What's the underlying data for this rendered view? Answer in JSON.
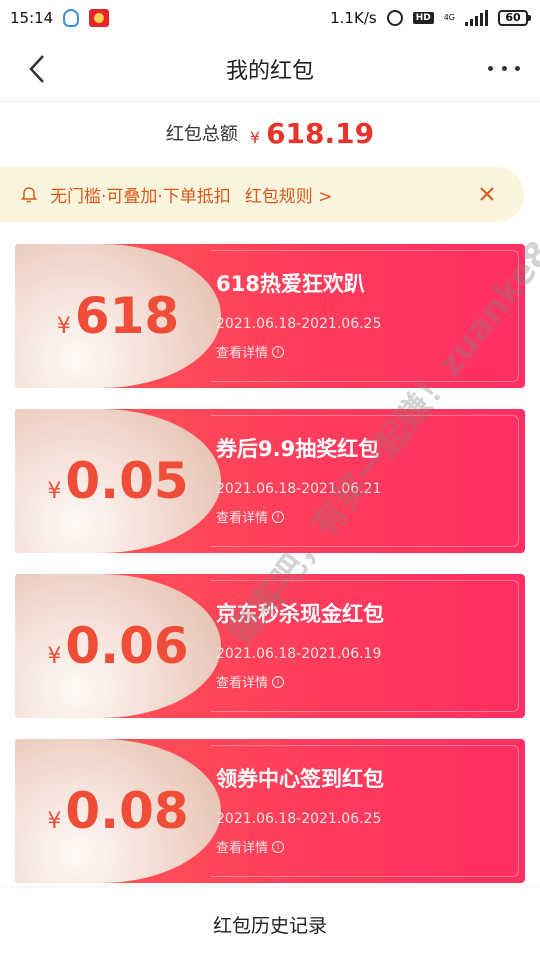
{
  "status_bar": {
    "time": "15:14",
    "speed": "1.1K/s",
    "hd": "HD",
    "network": "4G",
    "battery": "60"
  },
  "nav": {
    "title": "我的红包"
  },
  "summary": {
    "label": "红包总额",
    "currency": "¥",
    "amount": "618.19"
  },
  "notice": {
    "text": "无门槛·可叠加·下单抵扣",
    "link": "红包规则 >"
  },
  "coupons": [
    {
      "currency": "¥",
      "value": "618",
      "name": "618热爱狂欢趴",
      "date": "2021.06.18-2021.06.25",
      "detail": "查看详情"
    },
    {
      "currency": "¥",
      "value": "0.05",
      "name": "券后9.9抽奖红包",
      "date": "2021.06.18-2021.06.21",
      "detail": "查看详情"
    },
    {
      "currency": "¥",
      "value": "0.06",
      "name": "京东秒杀现金红包",
      "date": "2021.06.18-2021.06.19",
      "detail": "查看详情"
    },
    {
      "currency": "¥",
      "value": "0.08",
      "name": "领券中心签到红包",
      "date": "2021.06.18-2021.06.25",
      "detail": "查看详情"
    }
  ],
  "watermark": "赚客吧，有奖一起赚！zuanke8.com",
  "bottom": {
    "history_label": "红包历史记录"
  },
  "colors": {
    "accent": "#e8322a",
    "coupon_red": "#ff3b5c",
    "notice_bg": "#fcf5dd",
    "notice_text": "#d9591c"
  }
}
